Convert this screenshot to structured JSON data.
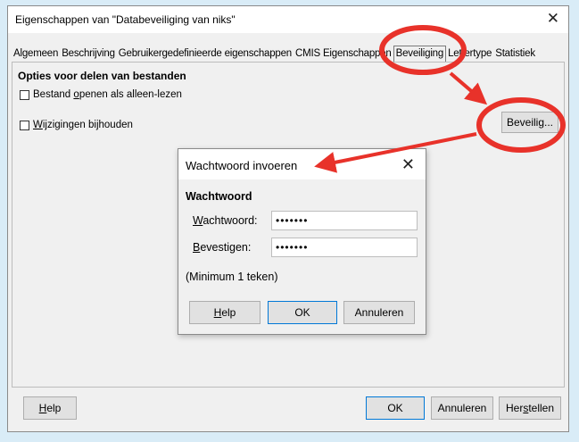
{
  "window": {
    "title": "Eigenschappen van \"Databeveiliging van niks\"",
    "close_glyph": "✕"
  },
  "tabs": [
    {
      "label": "Algemeen",
      "active": false
    },
    {
      "label": "Beschrijving",
      "active": false
    },
    {
      "label": "Gebruikergedefinieerde eigenschappen",
      "active": false
    },
    {
      "label": "CMIS Eigenschappen",
      "active": false
    },
    {
      "label": "Beveiliging",
      "active": true
    },
    {
      "label": "Lettertype",
      "active": false
    },
    {
      "label": "Statistiek",
      "active": false
    }
  ],
  "security": {
    "section_title": "Opties voor delen van bestanden",
    "readonly_label_pre": "Bestand ",
    "readonly_label_u": "o",
    "readonly_label_post": "penen als alleen-lezen",
    "track_label_u": "W",
    "track_label_post": "ijzigingen bijhouden",
    "protect_button_pre": "Beveili",
    "protect_button_u": "g",
    "protect_button_post": "..."
  },
  "dialog": {
    "title": "Wachtwoord invoeren",
    "close_glyph": "✕",
    "section_title": "Wachtwoord",
    "password_label_u": "W",
    "password_label_post": "achtwoord:",
    "password_value": "•••••••",
    "confirm_label_u": "B",
    "confirm_label_post": "evestigen:",
    "confirm_value": "•••••••",
    "note": "(Minimum 1 teken)",
    "help_u": "H",
    "help_post": "elp",
    "ok": "OK",
    "cancel": "Annuleren"
  },
  "footer": {
    "help_u": "H",
    "help_post": "elp",
    "ok": "OK",
    "cancel": "Annuleren",
    "reset_pre": "Her",
    "reset_u": "s",
    "reset_post": "tellen"
  },
  "colors": {
    "annotation": "#e8322a",
    "background": "#d9ecf7"
  }
}
